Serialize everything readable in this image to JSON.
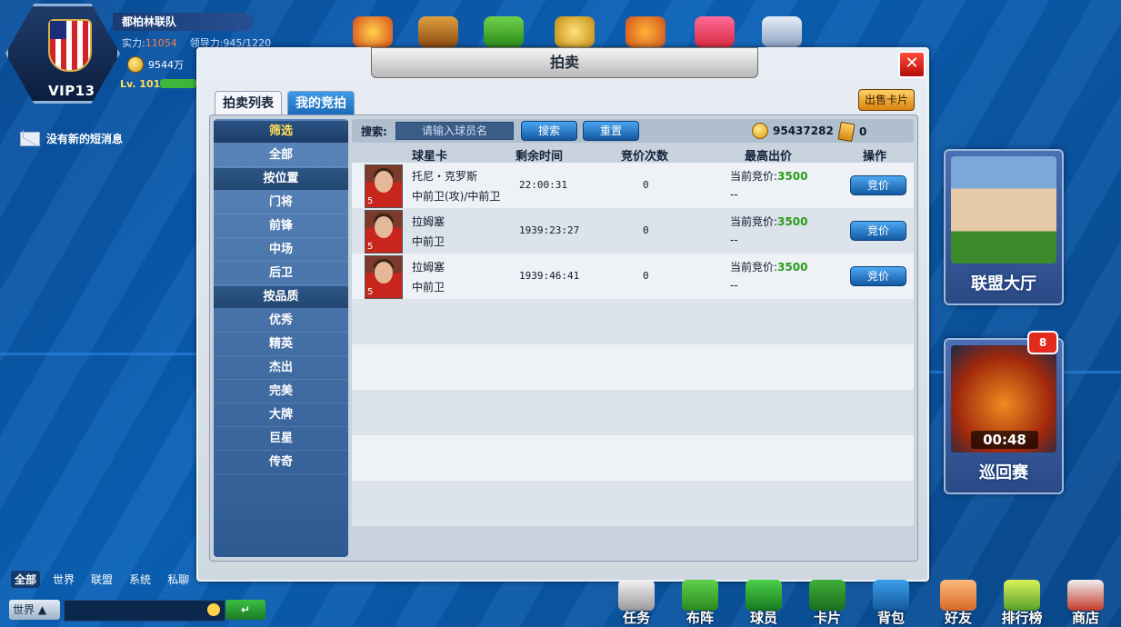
{
  "profile": {
    "team_name": "都柏林联队",
    "power_label": "实力:",
    "power_value": "11054",
    "leadership_label": "领导力:945/1220",
    "coins": "9544万",
    "level": "Lv. 101",
    "vip": "VIP13"
  },
  "messages": {
    "no_new": "没有新的短消息"
  },
  "dialog": {
    "title": "拍卖",
    "close_symbol": "✕",
    "tabs": [
      "拍卖列表",
      "我的竞拍"
    ],
    "sell_button": "出售卡片",
    "search": {
      "label": "搜索:",
      "placeholder": "请输入球员名",
      "search_button": "搜索",
      "reset_button": "重置"
    },
    "balance_coins": "95437282",
    "balance_cards": "0",
    "filters": {
      "header": "筛选",
      "all": "全部",
      "position_title": "按位置",
      "positions": [
        "门将",
        "前锋",
        "中场",
        "后卫"
      ],
      "quality_title": "按品质",
      "qualities": [
        "优秀",
        "精英",
        "杰出",
        "完美",
        "大牌",
        "巨星",
        "传奇"
      ]
    },
    "table": {
      "headers": [
        "球星卡",
        "剩余时间",
        "竞价次数",
        "最高出价",
        "操作"
      ],
      "rows": [
        {
          "level": "5",
          "name": "托尼・克罗斯",
          "position": "中前卫(攻)/中前卫",
          "time": "22:00:31",
          "bids": "0",
          "price_label": "当前竞价:",
          "price": "3500",
          "top_bidder": "--",
          "action": "竞价"
        },
        {
          "level": "5",
          "name": "拉姆塞",
          "position": "中前卫",
          "time": "1939:23:27",
          "bids": "0",
          "price_label": "当前竞价:",
          "price": "3500",
          "top_bidder": "--",
          "action": "竞价"
        },
        {
          "level": "5",
          "name": "拉姆塞",
          "position": "中前卫",
          "time": "1939:46:41",
          "bids": "0",
          "price_label": "当前竞价:",
          "price": "3500",
          "top_bidder": "--",
          "action": "竞价"
        }
      ]
    }
  },
  "side_cards": {
    "league_hall": "联盟大厅",
    "tour": "巡回赛",
    "tour_badge": "8",
    "tour_timer": "00:48"
  },
  "chat": {
    "tabs": [
      "全部",
      "世界",
      "联盟",
      "系统",
      "私聊"
    ],
    "channel": "世界",
    "send_symbol": "↵"
  },
  "bottom_nav": [
    "任务",
    "布阵",
    "球员",
    "卡片",
    "背包",
    "好友",
    "排行榜",
    "商店"
  ],
  "colors": {
    "accent_blue": "#1a67b7",
    "price_green": "#2a9b1c",
    "close_red": "#e22a1d"
  }
}
